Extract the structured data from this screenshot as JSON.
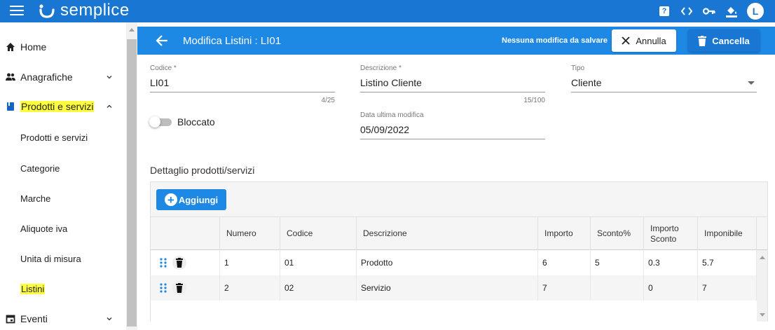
{
  "app": {
    "brand": "semplice",
    "avatar_initial": "L",
    "help_label": "?"
  },
  "colors": {
    "primary": "#1976d2",
    "header": "#1e88e5",
    "highlight": "#ffff40"
  },
  "topbar_icons": [
    "help-icon",
    "code-icon",
    "key-icon",
    "paint-bucket-icon",
    "avatar"
  ],
  "sidebar": {
    "items": [
      {
        "label": "Home",
        "icon": "home-icon"
      },
      {
        "label": "Anagrafiche",
        "icon": "people-icon",
        "expand": "chevron-down-icon"
      },
      {
        "label": "Prodotti e servizi",
        "icon": "book-icon",
        "expand": "chevron-up-icon",
        "highlighted": true
      },
      {
        "label": "Prodotti e servizi"
      },
      {
        "label": "Categorie"
      },
      {
        "label": "Marche"
      },
      {
        "label": "Aliquote iva"
      },
      {
        "label": "Unita di misura"
      },
      {
        "label": "Listini",
        "highlighted": true
      },
      {
        "label": "Eventi",
        "icon": "calendar-icon",
        "expand": "chevron-down-icon"
      }
    ]
  },
  "pagebar": {
    "title": "Modifica Listini : LI01",
    "status": "Nessuna modifica da salvare",
    "cancel_label": "Annulla",
    "delete_label": "Cancella"
  },
  "form": {
    "codice": {
      "label": "Codice *",
      "value": "LI01",
      "counter": "4/25"
    },
    "descrizione": {
      "label": "Descrizione *",
      "value": "Listino Cliente",
      "counter": "15/100"
    },
    "tipo": {
      "label": "Tipo",
      "value": "Cliente"
    },
    "bloccato": {
      "label": "Bloccato",
      "checked": false
    },
    "data_modifica": {
      "label": "Data ultima modifica",
      "value": "05/09/2022"
    }
  },
  "detail": {
    "title": "Dettaglio prodotti/servizi",
    "add_label": "Aggiungi",
    "columns": [
      "Numero",
      "Codice",
      "Descrizione",
      "Importo",
      "Sconto%",
      "Importo Sconto",
      "Imponibile"
    ],
    "rows": [
      {
        "numero": "1",
        "codice": "01",
        "descrizione": "Prodotto",
        "importo": "6",
        "sconto": "5",
        "importo_sconto": "0.3",
        "imponibile": "5.7"
      },
      {
        "numero": "2",
        "codice": "02",
        "descrizione": "Servizio",
        "importo": "7",
        "sconto": "",
        "importo_sconto": "0",
        "imponibile": "7"
      }
    ]
  }
}
